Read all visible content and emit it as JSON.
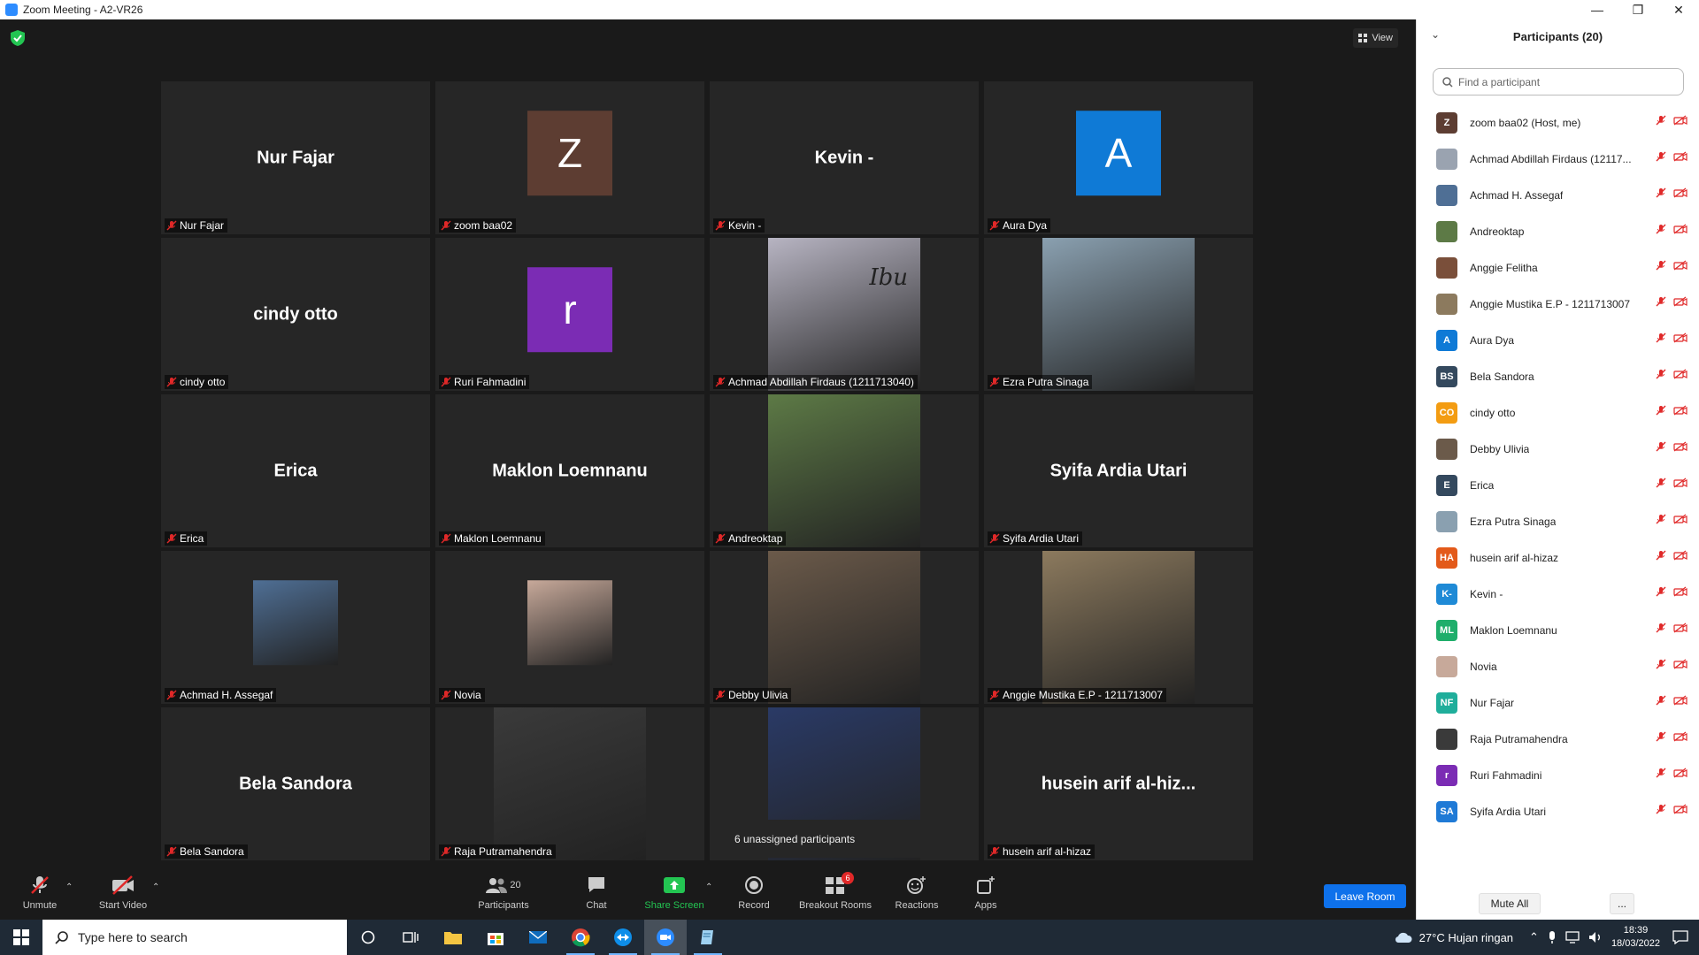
{
  "window": {
    "title": "Zoom Meeting - A2-VR26"
  },
  "view_button": {
    "label": "View"
  },
  "tiles": [
    {
      "display_name": "Nur Fajar",
      "label": "Nur Fajar",
      "kind": "name"
    },
    {
      "display_name": "Z",
      "label": "zoom baa02",
      "kind": "avatar",
      "color": "#5d3d32"
    },
    {
      "display_name": "Kevin -",
      "label": "Kevin -",
      "kind": "name"
    },
    {
      "display_name": "A",
      "label": "Aura Dya",
      "kind": "avatar",
      "color": "#0f7ad6"
    },
    {
      "display_name": "cindy otto",
      "label": "cindy otto",
      "kind": "name"
    },
    {
      "display_name": "r",
      "label": "Ruri Fahmadini",
      "kind": "avatar",
      "color": "#7b2cb4"
    },
    {
      "display_name": "",
      "label": "Achmad Abdillah Firdaus (1211713040)",
      "kind": "photo",
      "color": "#b7b4c2",
      "overlay": "Ibu"
    },
    {
      "display_name": "",
      "label": "Ezra Putra Sinaga",
      "kind": "photo",
      "color": "#8aa0b0"
    },
    {
      "display_name": "Erica",
      "label": "Erica",
      "kind": "name"
    },
    {
      "display_name": "Maklon Loemnanu",
      "label": "Maklon Loemnanu",
      "kind": "name"
    },
    {
      "display_name": "",
      "label": "Andreoktap",
      "kind": "photo",
      "color": "#5d7a46"
    },
    {
      "display_name": "Syifa Ardia Utari",
      "label": "Syifa Ardia Utari",
      "kind": "name"
    },
    {
      "display_name": "",
      "label": "Achmad H. Assegaf",
      "kind": "photo-sm",
      "color": "#4f6f95"
    },
    {
      "display_name": "",
      "label": "Novia",
      "kind": "photo-sm",
      "color": "#c7a99a"
    },
    {
      "display_name": "",
      "label": "Debby Ulivia",
      "kind": "photo",
      "color": "#6b5a4a"
    },
    {
      "display_name": "",
      "label": "Anggie Mustika E.P - 1211713007",
      "kind": "photo",
      "color": "#8c7a5e"
    },
    {
      "display_name": "Bela Sandora",
      "label": "Bela Sandora",
      "kind": "name"
    },
    {
      "display_name": "",
      "label": "Raja Putramahendra",
      "kind": "photo",
      "color": "#3a3a3a"
    },
    {
      "display_name": "",
      "label": "",
      "kind": "photo",
      "color": "#2a3a66"
    },
    {
      "display_name": "husein arif al-hiz...",
      "label": "husein arif al-hizaz",
      "kind": "name"
    }
  ],
  "unassigned_popup": {
    "text": "6 unassigned participants"
  },
  "toolbar": {
    "unmute": "Unmute",
    "start_video": "Start Video",
    "participants": "Participants",
    "participants_count": "20",
    "chat": "Chat",
    "share_screen": "Share Screen",
    "record": "Record",
    "breakout_rooms": "Breakout Rooms",
    "breakout_badge": "6",
    "reactions": "Reactions",
    "apps": "Apps",
    "leave_room": "Leave Room"
  },
  "panel": {
    "title": "Participants (20)",
    "search_placeholder": "Find a participant",
    "mute_all": "Mute All",
    "more": "...",
    "participants": [
      {
        "name": "zoom baa02 (Host, me)",
        "initials": "Z",
        "color": "#5d3d32"
      },
      {
        "name": "Achmad Abdillah Firdaus (12117...",
        "initials": "",
        "color": "#9aa3b0"
      },
      {
        "name": "Achmad H. Assegaf",
        "initials": "",
        "color": "#4f6f95"
      },
      {
        "name": "Andreoktap",
        "initials": "",
        "color": "#5d7a46"
      },
      {
        "name": "Anggie Felitha",
        "initials": "",
        "color": "#7a4f3a"
      },
      {
        "name": "Anggie Mustika E.P - 1211713007",
        "initials": "",
        "color": "#8c7a5e"
      },
      {
        "name": "Aura Dya",
        "initials": "A",
        "color": "#0f7ad6"
      },
      {
        "name": "Bela Sandora",
        "initials": "BS",
        "color": "#34495e"
      },
      {
        "name": "cindy otto",
        "initials": "CO",
        "color": "#f39c12"
      },
      {
        "name": "Debby Ulivia",
        "initials": "",
        "color": "#6b5a4a"
      },
      {
        "name": "Erica",
        "initials": "E",
        "color": "#34495e"
      },
      {
        "name": "Ezra Putra Sinaga",
        "initials": "",
        "color": "#8aa0b0"
      },
      {
        "name": "husein arif al-hizaz",
        "initials": "HA",
        "color": "#e35a1a"
      },
      {
        "name": "Kevin -",
        "initials": "K-",
        "color": "#1f8ad6"
      },
      {
        "name": "Maklon Loemnanu",
        "initials": "ML",
        "color": "#1fae6b"
      },
      {
        "name": "Novia",
        "initials": "",
        "color": "#c7a99a"
      },
      {
        "name": "Nur Fajar",
        "initials": "NF",
        "color": "#1fae9b"
      },
      {
        "name": "Raja Putramahendra",
        "initials": "",
        "color": "#3a3a3a"
      },
      {
        "name": "Ruri Fahmadini",
        "initials": "r",
        "color": "#7b2cb4"
      },
      {
        "name": "Syifa Ardia Utari",
        "initials": "SA",
        "color": "#1f7ad6"
      }
    ]
  },
  "taskbar": {
    "search_placeholder": "Type here to search",
    "weather": "27°C  Hujan ringan",
    "time": "18:39",
    "date": "18/03/2022"
  }
}
